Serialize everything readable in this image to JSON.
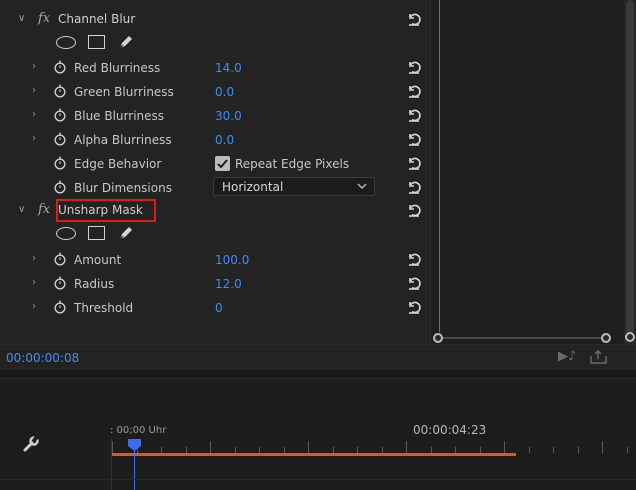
{
  "effect_controls": {
    "timecode": "00:00:00:08",
    "effects": [
      {
        "name": "Channel Blur",
        "fx_label": "fx",
        "properties": [
          {
            "label": "Red Blurriness",
            "value": "14.0"
          },
          {
            "label": "Green Blurriness",
            "value": "0.0"
          },
          {
            "label": "Blue Blurriness",
            "value": "30.0"
          },
          {
            "label": "Alpha Blurriness",
            "value": "0.0"
          },
          {
            "label": "Edge Behavior",
            "checkbox_label": "Repeat Edge Pixels",
            "checked": true
          },
          {
            "label": "Blur Dimensions",
            "dropdown_value": "Horizontal"
          }
        ]
      },
      {
        "name": "Unsharp Mask",
        "fx_label": "fx",
        "highlighted": true,
        "properties": [
          {
            "label": "Amount",
            "value": "100.0"
          },
          {
            "label": "Radius",
            "value": "12.0"
          },
          {
            "label": "Threshold",
            "value": "0"
          }
        ]
      }
    ]
  },
  "timeline": {
    "start_label": ": 00;00 Uhr",
    "end_timecode": "00:00:04:23"
  },
  "colors": {
    "accent_blue": "#3f8cf5",
    "playhead_blue": "#3d6cf0",
    "work_area": "#e5542b",
    "highlight_red": "#e01b1b"
  },
  "icons": {
    "fx": "fx-icon",
    "stopwatch": "stopwatch-icon",
    "reset": "reset-icon",
    "ellipse_mask": "ellipse-mask-icon",
    "rect_mask": "rectangle-mask-icon",
    "pen_mask": "pen-mask-icon",
    "wrench": "wrench-icon"
  }
}
